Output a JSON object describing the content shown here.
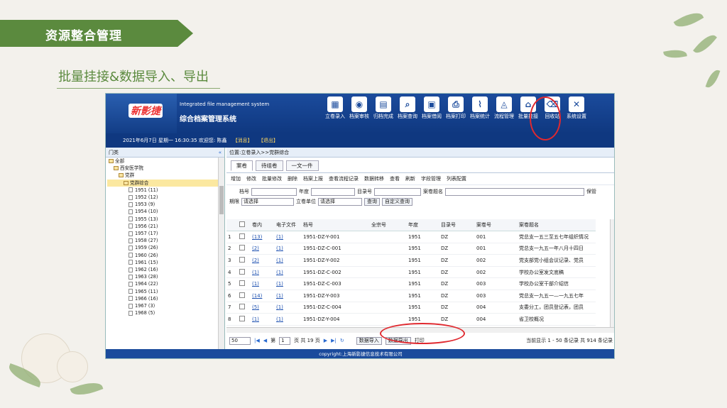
{
  "slide": {
    "banner_title": "资源整合管理",
    "subtitle": "批量挂接&数据导入、导出"
  },
  "app": {
    "logo_text": "新影捷",
    "system_en": "Integrated file management system",
    "system_cn": "综合档案管理系统",
    "toolbar": [
      {
        "icon": "grid-icon",
        "glyph": "▦",
        "label": "立卷录入"
      },
      {
        "icon": "user-icon",
        "glyph": "◉",
        "label": "档案审核"
      },
      {
        "icon": "doc-icon",
        "glyph": "▤",
        "label": "归档完成"
      },
      {
        "icon": "search-doc-icon",
        "glyph": "⌕",
        "label": "档案查询"
      },
      {
        "icon": "borrow-icon",
        "glyph": "▣",
        "label": "档案借阅"
      },
      {
        "icon": "print-icon",
        "glyph": "⎙",
        "label": "档案打印"
      },
      {
        "icon": "chart-icon",
        "glyph": "⌇",
        "label": "档案统计"
      },
      {
        "icon": "flow-icon",
        "glyph": "◬",
        "label": "流程管理"
      },
      {
        "icon": "home-icon",
        "glyph": "⌂",
        "label": "批量挂接"
      },
      {
        "icon": "trash-icon",
        "glyph": "⌫",
        "label": "回收站"
      },
      {
        "icon": "tools-icon",
        "glyph": "✕",
        "label": "系统设置"
      }
    ],
    "infobar": {
      "datetime": "2021年6月7日 星期一  16:30:35",
      "welcome": "欢迎您: 陈鑫",
      "messages": "【消息】",
      "logout": "【退出】"
    },
    "left_pane": {
      "header": "门类",
      "collapse": "«",
      "tree": [
        {
          "label": "全部",
          "level": 0,
          "type": "check"
        },
        {
          "label": "西安医学院",
          "level": 1,
          "type": "folder"
        },
        {
          "label": "党群",
          "level": 2,
          "type": "folder"
        },
        {
          "label": "党群综合",
          "level": 3,
          "type": "folder",
          "selected": true
        },
        {
          "label": "1951 (11)",
          "level": 4,
          "type": "doc"
        },
        {
          "label": "1952 (12)",
          "level": 4,
          "type": "doc"
        },
        {
          "label": "1953 (9)",
          "level": 4,
          "type": "doc"
        },
        {
          "label": "1954 (10)",
          "level": 4,
          "type": "doc"
        },
        {
          "label": "1955 (13)",
          "level": 4,
          "type": "doc"
        },
        {
          "label": "1956 (21)",
          "level": 4,
          "type": "doc"
        },
        {
          "label": "1957 (17)",
          "level": 4,
          "type": "doc"
        },
        {
          "label": "1958 (27)",
          "level": 4,
          "type": "doc"
        },
        {
          "label": "1959 (26)",
          "level": 4,
          "type": "doc"
        },
        {
          "label": "1960 (26)",
          "level": 4,
          "type": "doc"
        },
        {
          "label": "1961 (15)",
          "level": 4,
          "type": "doc"
        },
        {
          "label": "1962 (16)",
          "level": 4,
          "type": "doc"
        },
        {
          "label": "1963 (28)",
          "level": 4,
          "type": "doc"
        },
        {
          "label": "1964 (22)",
          "level": 4,
          "type": "doc"
        },
        {
          "label": "1965 (11)",
          "level": 4,
          "type": "doc"
        },
        {
          "label": "1966 (16)",
          "level": 4,
          "type": "doc"
        },
        {
          "label": "1967 (3)",
          "level": 4,
          "type": "doc"
        },
        {
          "label": "1968 (5)",
          "level": 4,
          "type": "doc"
        }
      ]
    },
    "right_pane": {
      "location": "位置:立卷录入>>党群综合",
      "tabs": [
        "案卷",
        "待组卷",
        "一文一件"
      ],
      "actions": [
        "增加",
        "修改",
        "批量修改",
        "删除",
        "档案上报",
        "查看流程记录",
        "数据转移",
        "查看",
        "刷新",
        "字段管理",
        "列表配置"
      ],
      "filters": {
        "archive_no": "档号",
        "year": "年度",
        "catalog_no": "目录号",
        "title": "案卷题名",
        "retention": "期限",
        "retention_value": "请选择",
        "unit": "立卷单位",
        "unit_value": "请选择",
        "query": "查询",
        "custom_query": "自定义查询",
        "save": "保管"
      },
      "columns": [
        "",
        "",
        "卷内",
        "电子文件",
        "档号",
        "全宗号",
        "年度",
        "目录号",
        "案卷号",
        "案卷题名"
      ],
      "rows": [
        [
          "1",
          "(13)",
          "(1)",
          "1951-DZ-Y-001",
          "",
          "1951",
          "DZ",
          "001",
          "党总支一五三至五七年组织情况"
        ],
        [
          "2",
          "(2)",
          "(1)",
          "1951-DZ-C-001",
          "",
          "1951",
          "DZ",
          "001",
          "党总支一九五一年八月十四日"
        ],
        [
          "3",
          "(2)",
          "(1)",
          "1951-DZ-Y-002",
          "",
          "1951",
          "DZ",
          "002",
          "党支部党小组会议记录、党员"
        ],
        [
          "4",
          "(1)",
          "(1)",
          "1951-DZ-C-002",
          "",
          "1951",
          "DZ",
          "002",
          "学校办公室发文底稿"
        ],
        [
          "5",
          "(1)",
          "(1)",
          "1951-DZ-C-003",
          "",
          "1951",
          "DZ",
          "003",
          "学校办公室干部介绍信"
        ],
        [
          "6",
          "(14)",
          "(1)",
          "1951-DZ-Y-003",
          "",
          "1951",
          "DZ",
          "003",
          "党总支一九五一—一九五七年"
        ],
        [
          "7",
          "(5)",
          "(1)",
          "1951-DZ-C-004",
          "",
          "1951",
          "DZ",
          "004",
          "支委分工，团员登记表，团员"
        ],
        [
          "8",
          "(1)",
          "(1)",
          "1951-DZ-Y-004",
          "",
          "1951",
          "DZ",
          "004",
          "省卫校概况"
        ]
      ],
      "next_row_no": "9",
      "pager": {
        "page_size": "50",
        "page_label": "第",
        "page_value": "1",
        "page_total": "页 共 19 页",
        "import": "数据导入",
        "export": "数据导出",
        "print": "打印",
        "summary": "当前显示 1 - 50 条记录 共 914 条记录"
      }
    },
    "footer": "copyright:上海新影捷信息技术有限公司"
  },
  "colors": {
    "brand_green": "#5b8a3e",
    "app_blue": "#1b4b9c",
    "highlight_red": "#e0292f"
  }
}
